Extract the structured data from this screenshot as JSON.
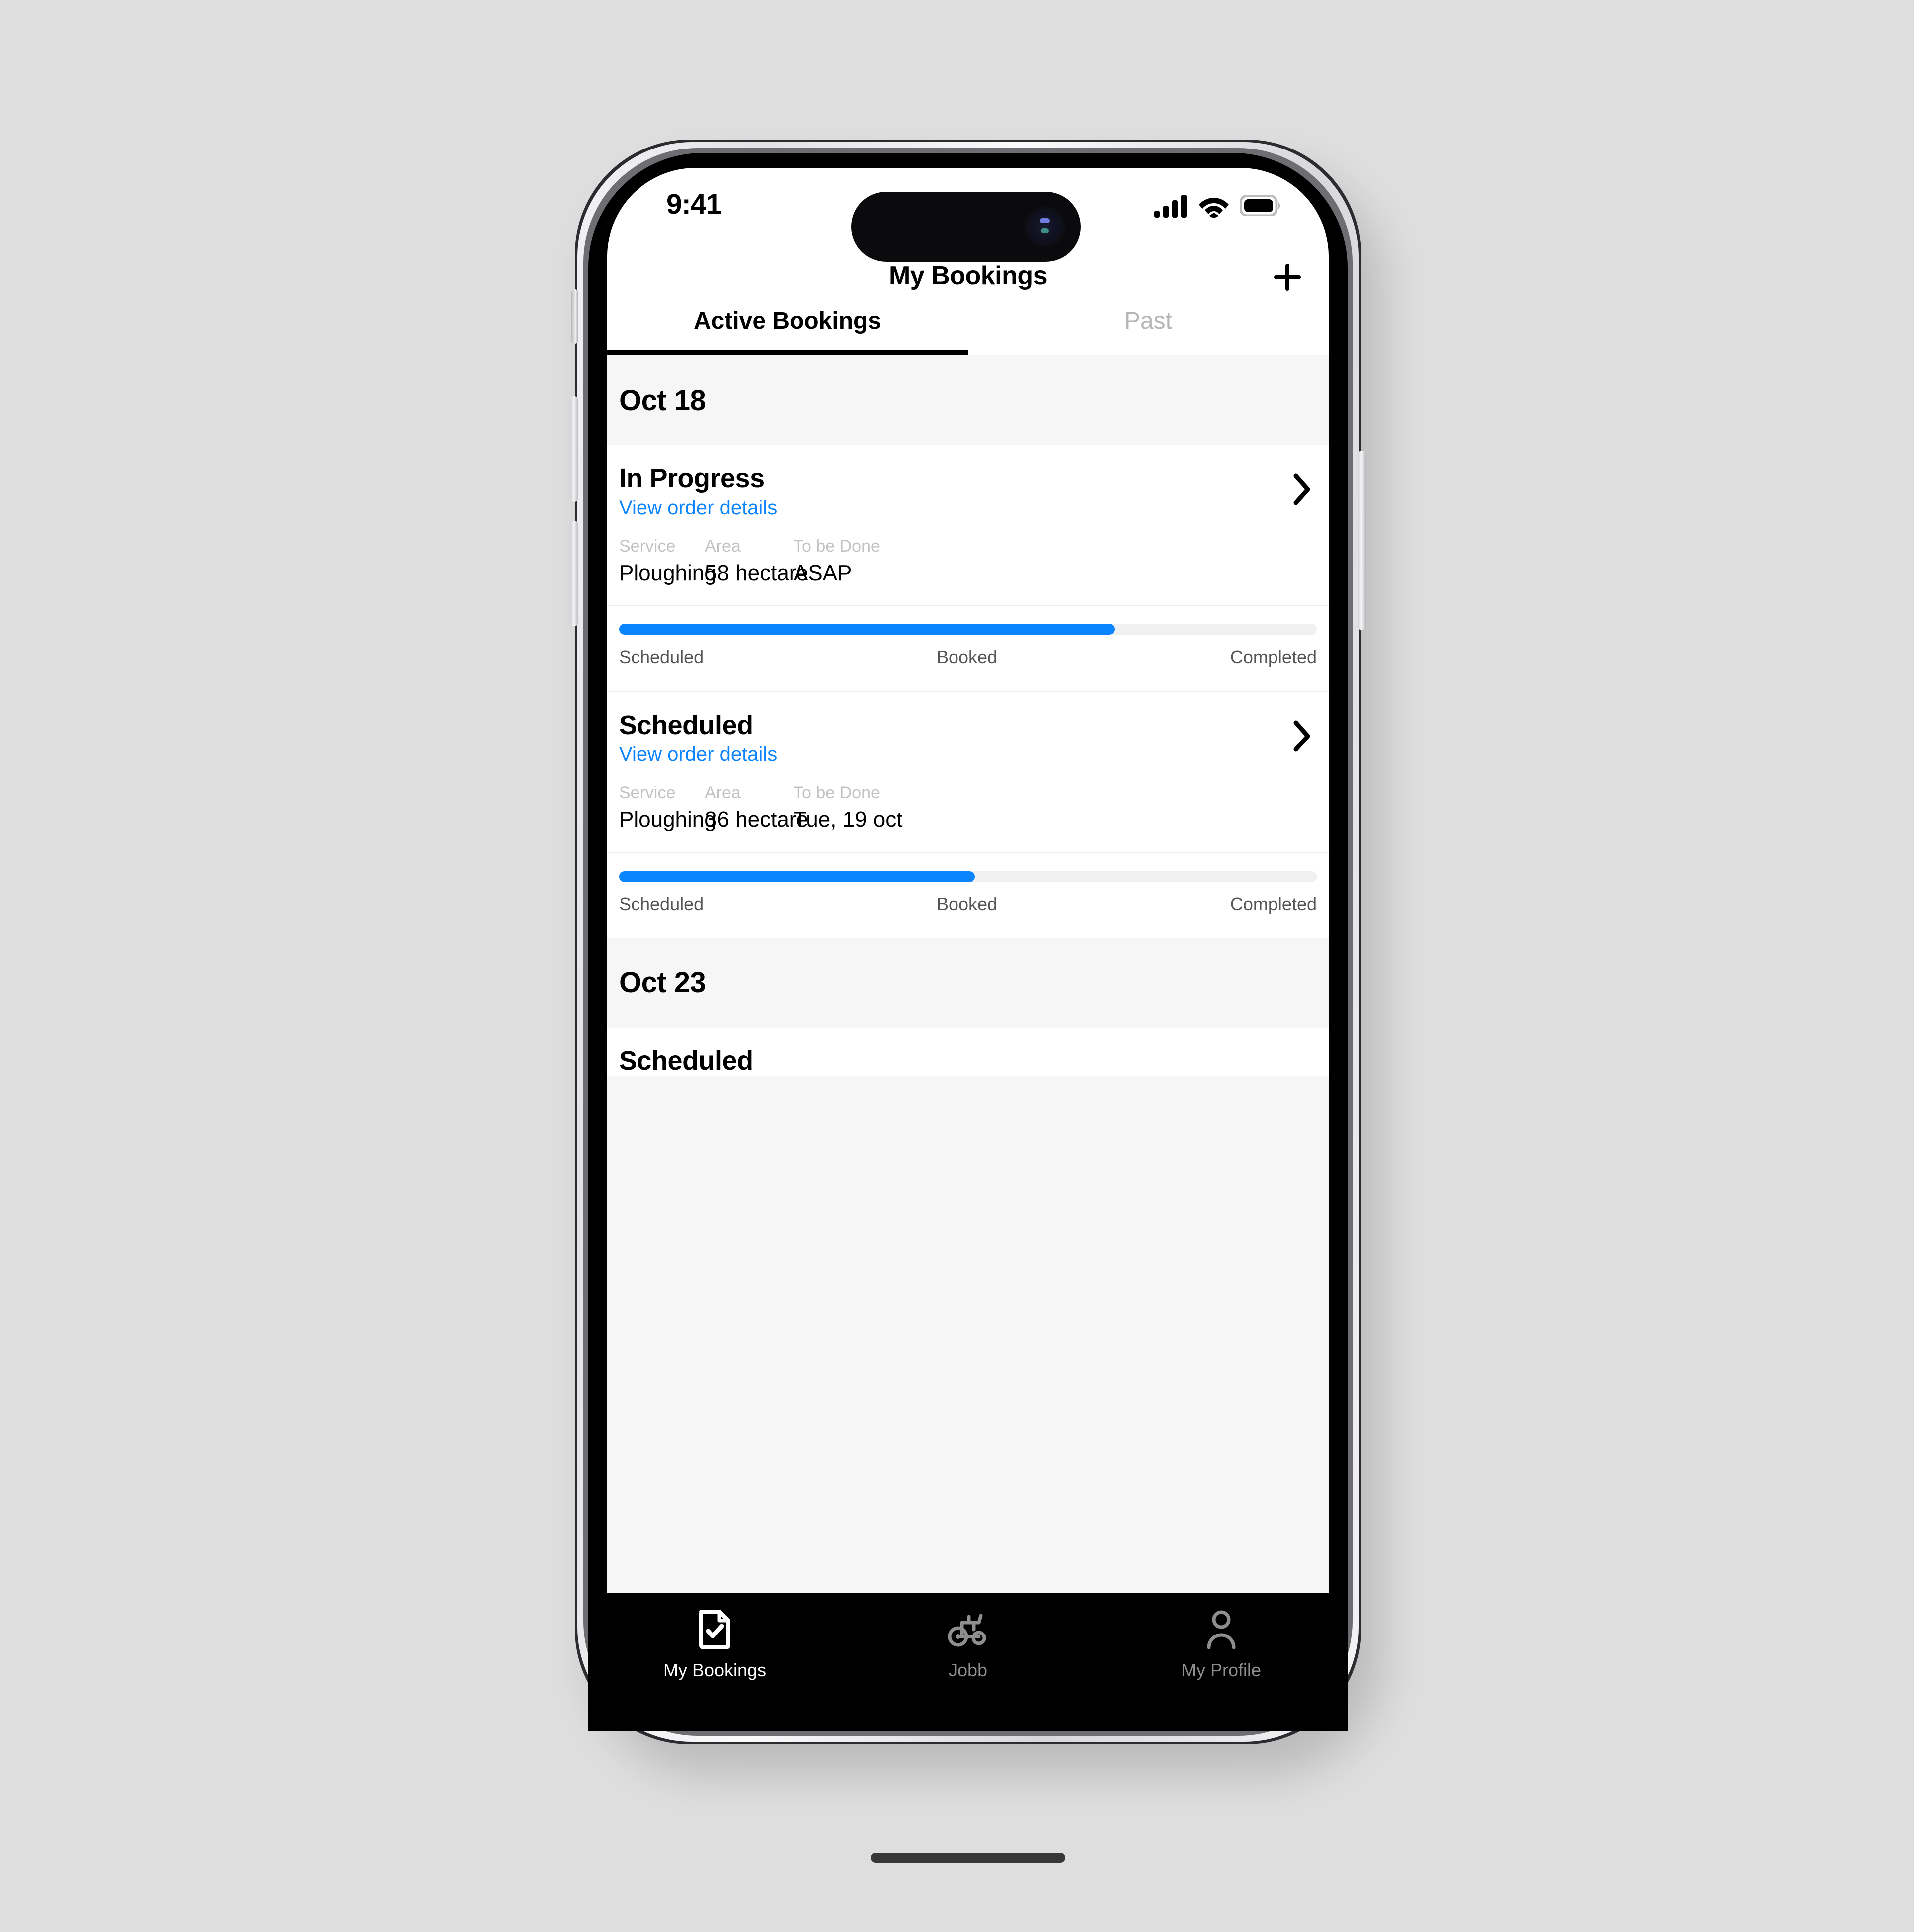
{
  "status_bar": {
    "time": "9:41",
    "icons": [
      "cellular-signal-icon",
      "wifi-icon",
      "battery-icon"
    ]
  },
  "nav": {
    "title": "My Bookings",
    "add_icon": "plus-icon"
  },
  "tabs": [
    {
      "label": "Active Bookings",
      "active": true
    },
    {
      "label": "Past",
      "active": false
    }
  ],
  "theme": {
    "accent_blue": "#0a84ff",
    "link_blue": "#0a84ff",
    "muted_grey": "#c2c2c2",
    "section_bg": "#f6f6f6",
    "card_bg": "#ffffff",
    "progress_track": "#f0f0f0",
    "tabbar_bg": "#000000"
  },
  "sections": [
    {
      "date": "Oct 18",
      "bookings": [
        {
          "status": "In Progress",
          "link": "View order details",
          "chevron": "chevron-right-icon",
          "fields": [
            {
              "label": "Service",
              "value": "Ploughing"
            },
            {
              "label": "Area",
              "value": "58 hectare"
            },
            {
              "label": "To be Done",
              "value": "ASAP"
            }
          ],
          "progress": {
            "percent": 71,
            "steps": [
              "Scheduled",
              "Booked",
              "Completed"
            ]
          }
        },
        {
          "status": "Scheduled",
          "link": "View order details",
          "chevron": "chevron-right-icon",
          "fields": [
            {
              "label": "Service",
              "value": "Ploughing"
            },
            {
              "label": "Area",
              "value": "36 hectare"
            },
            {
              "label": "To be Done",
              "value": "Tue, 19 oct"
            }
          ],
          "progress": {
            "percent": 51,
            "steps": [
              "Scheduled",
              "Booked",
              "Completed"
            ]
          }
        }
      ]
    },
    {
      "date": "Oct 23",
      "bookings": [
        {
          "status": "Scheduled",
          "link": "",
          "chevron": "chevron-right-icon",
          "fields": [],
          "progress": null
        }
      ]
    }
  ],
  "bottom_tabs": [
    {
      "label": "My Bookings",
      "icon": "document-check-icon",
      "active": true
    },
    {
      "label": "Jobb",
      "icon": "tractor-icon",
      "active": false
    },
    {
      "label": "My Profile",
      "icon": "person-icon",
      "active": false
    }
  ]
}
